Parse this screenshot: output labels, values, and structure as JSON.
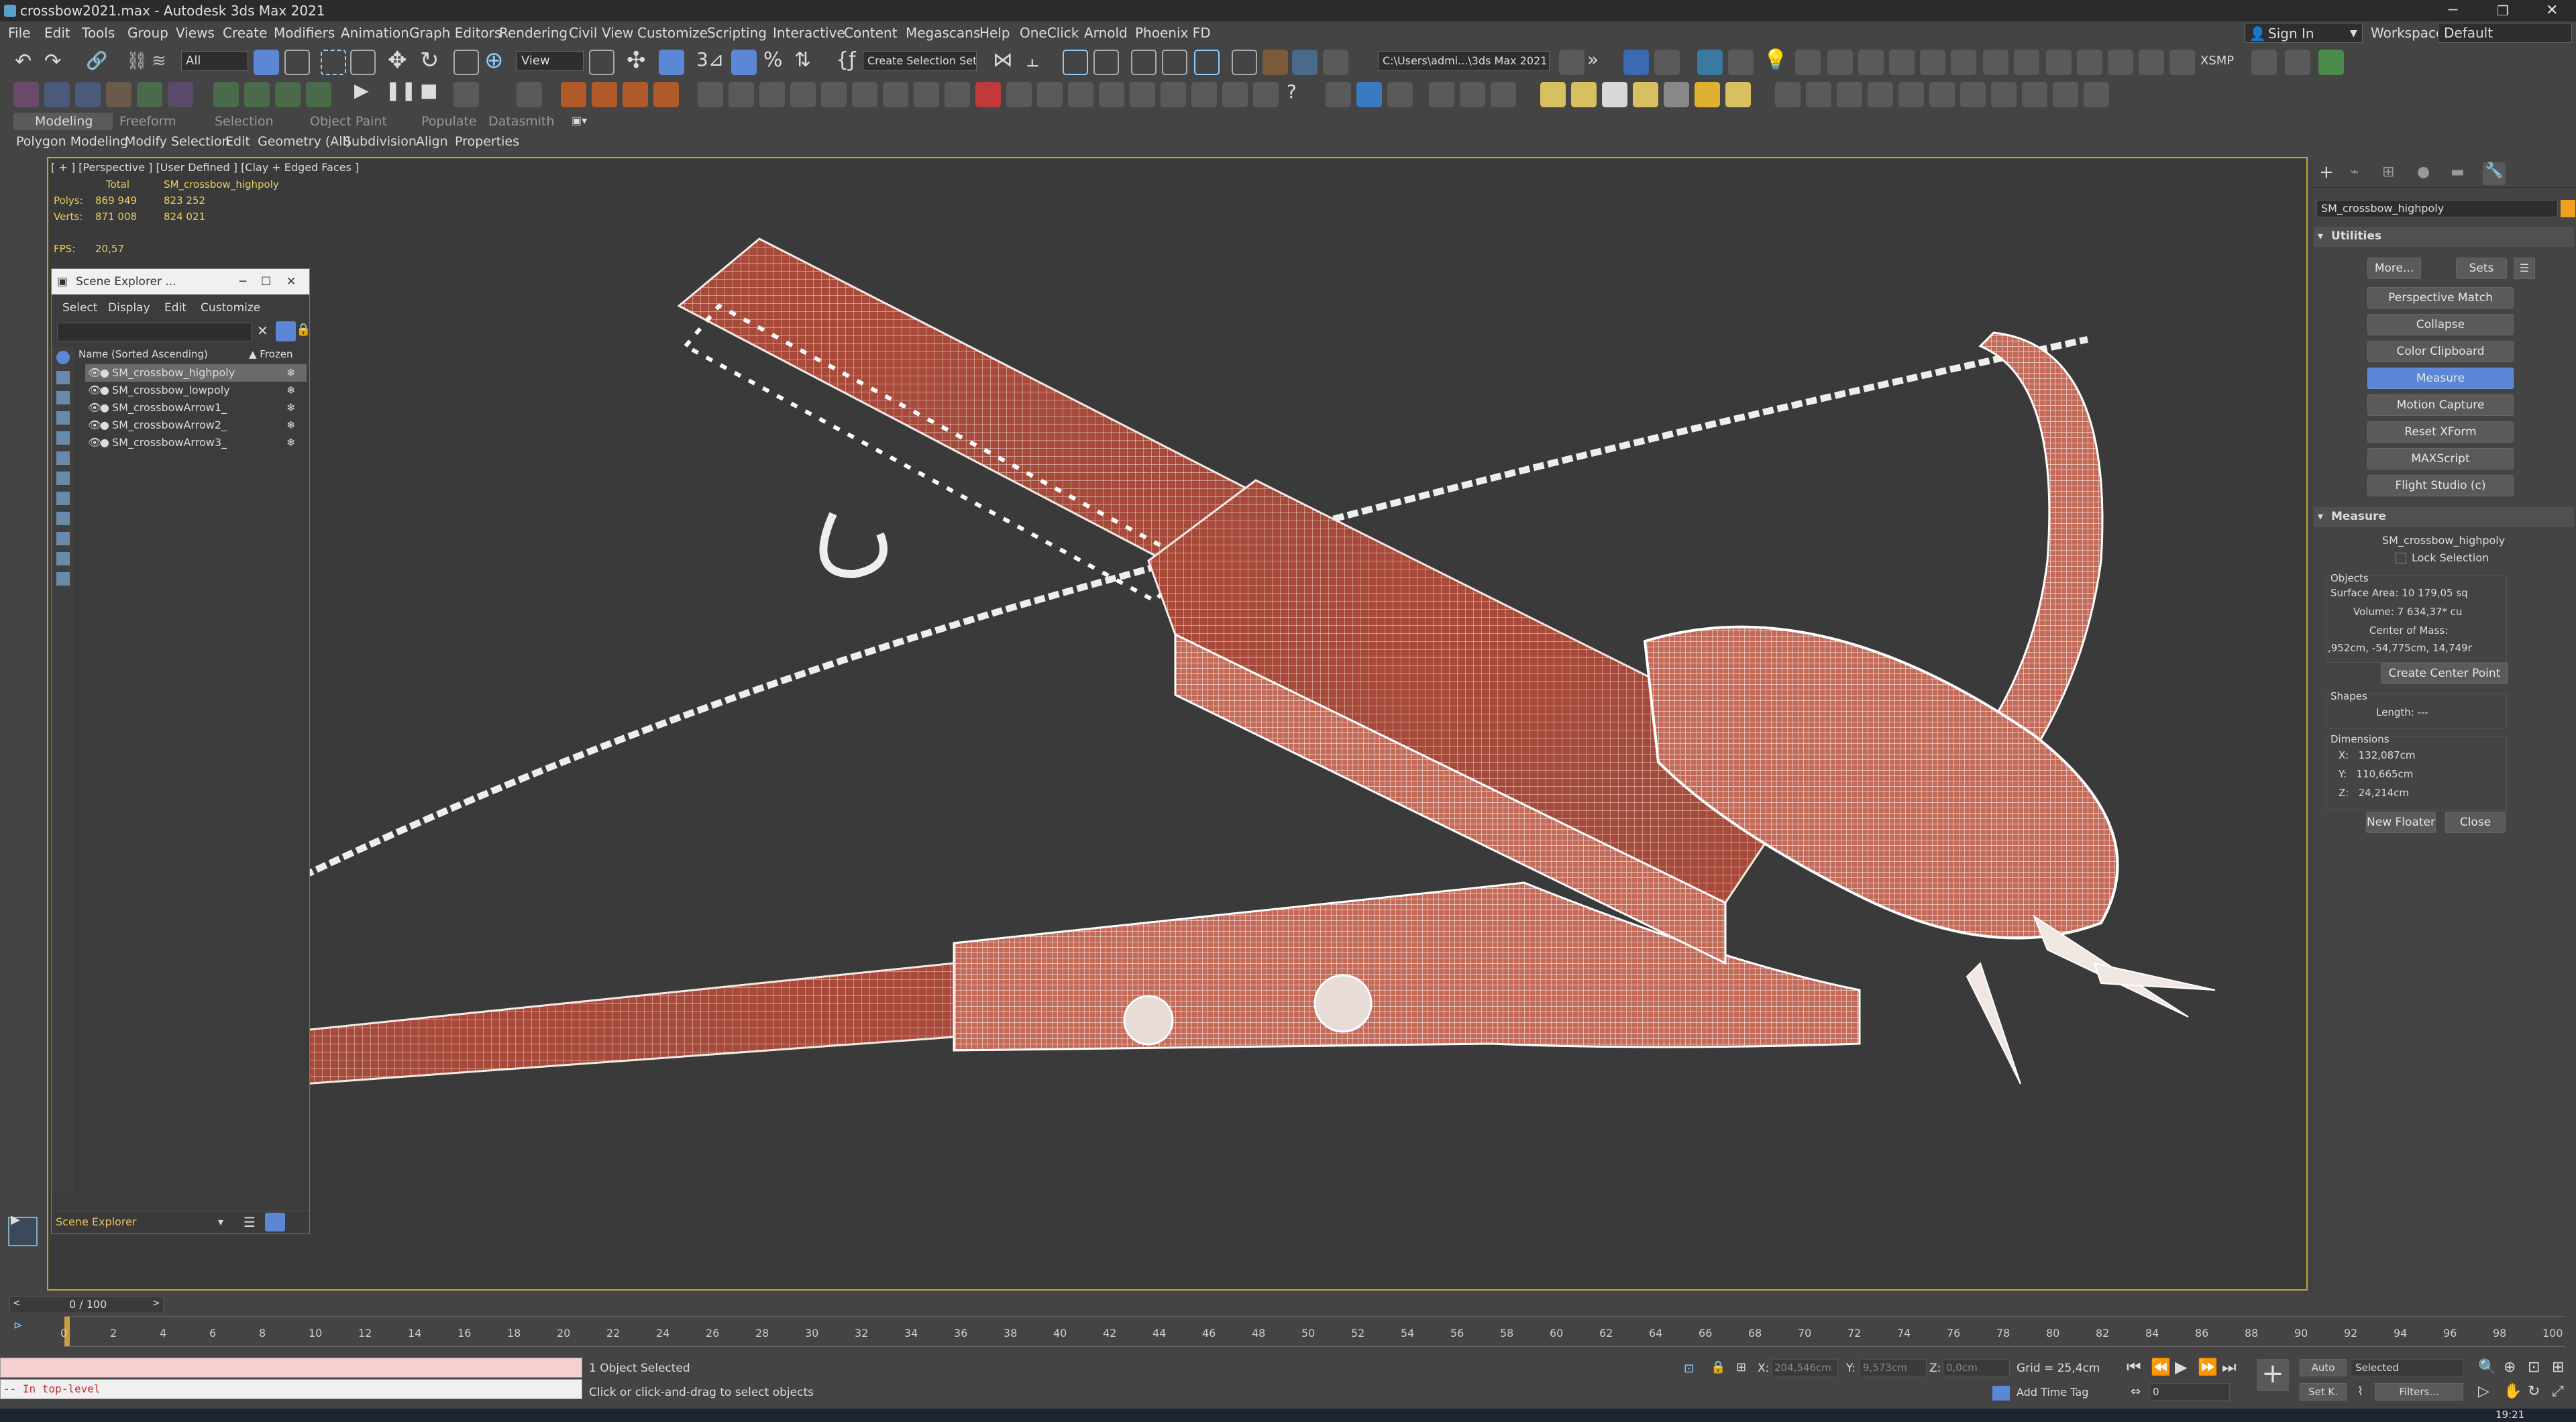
{
  "window": {
    "title": "crossbow2021.max - Autodesk 3ds Max 2021"
  },
  "menu": [
    "File",
    "Edit",
    "Tools",
    "Group",
    "Views",
    "Create",
    "Modifiers",
    "Animation",
    "Graph Editors",
    "Rendering",
    "Civil View",
    "Customize",
    "Scripting",
    "Interactive",
    "Content",
    "Megascans",
    "Help",
    "OneClick",
    "Arnold",
    "Phoenix FD"
  ],
  "account": {
    "sign_in": "Sign In",
    "workspaces_label": "Workspaces:",
    "workspace": "Default"
  },
  "toolbar": {
    "filter": "All",
    "ref_coord": "View",
    "selection_set": "Create Selection Set",
    "project_path": "C:\\Users\\admi...\\3ds Max 2021",
    "xsmp": "XSMP"
  },
  "ribbon": {
    "tabs": [
      "Modeling",
      "Freeform",
      "Selection",
      "Object Paint",
      "Populate",
      "Datasmith"
    ],
    "sub": [
      "Polygon Modeling",
      "Modify Selection",
      "Edit",
      "Geometry (All)",
      "Subdivision",
      "Align",
      "Properties"
    ]
  },
  "viewport": {
    "label": "[ + ] [Perspective ] [User Defined ] [Clay + Edged Faces ]",
    "stats": {
      "total": "Total",
      "object": "SM_crossbow_highpoly",
      "polys_label": "Polys:",
      "polys_total": "869 949",
      "polys_obj": "823 252",
      "verts_label": "Verts:",
      "verts_total": "871 008",
      "verts_obj": "824 021",
      "fps_label": "FPS:",
      "fps": "20,57"
    }
  },
  "scene_explorer": {
    "title": "Scene Explorer ...",
    "menu": [
      "Select",
      "Display",
      "Edit",
      "Customize"
    ],
    "col_name": "Name (Sorted Ascending)",
    "col_frozen": "▲ Frozen",
    "items": [
      "SM_crossbow_highpoly",
      "SM_crossbow_lowpoly",
      "SM_crossbowArrow1_",
      "SM_crossbowArrow2_",
      "SM_crossbowArrow3_"
    ],
    "footer": "Scene Explorer"
  },
  "panel": {
    "object_name": "SM_crossbow_highpoly",
    "utilities_title": "Utilities",
    "more": "More...",
    "sets": "Sets",
    "buttons": [
      "Perspective Match",
      "Collapse",
      "Color Clipboard",
      "Measure",
      "Motion Capture",
      "Reset XForm",
      "MAXScript",
      "Flight Studio (c)"
    ],
    "measure_title": "Measure",
    "measure_obj": "SM_crossbow_highpoly",
    "lock_selection": "Lock Selection",
    "objects_label": "Objects",
    "surface_area": "Surface Area: 10 179,05 sq",
    "volume": "Volume: 7 634,37* cu",
    "center_label": "Center of Mass:",
    "center": ",952cm, -54,775cm, 14,749r",
    "create_center": "Create Center Point",
    "shapes_label": "Shapes",
    "length": "Length: ---",
    "dimensions_label": "Dimensions",
    "dim_x": "X:   132,087cm",
    "dim_y": "Y:   110,665cm",
    "dim_z": "Z:   24,214cm",
    "new_floater": "New Floater",
    "close": "Close"
  },
  "timeline": {
    "frame": "0 / 100",
    "ticks": [
      "0",
      "2",
      "4",
      "6",
      "8",
      "10",
      "12",
      "14",
      "16",
      "18",
      "20",
      "22",
      "24",
      "26",
      "28",
      "30",
      "32",
      "34",
      "36",
      "38",
      "40",
      "42",
      "44",
      "46",
      "48",
      "50",
      "52",
      "54",
      "56",
      "58",
      "60",
      "62",
      "64",
      "66",
      "68",
      "70",
      "72",
      "74",
      "76",
      "78",
      "80",
      "82",
      "84",
      "86",
      "88",
      "90",
      "92",
      "94",
      "96",
      "98",
      "100"
    ]
  },
  "status": {
    "script": "-- In top-level",
    "selected": "1 Object Selected",
    "hint": "Click or click-and-drag to select objects",
    "x_label": "X:",
    "x": "204,546cm",
    "y_label": "Y:",
    "y": "9,573cm",
    "z_label": "Z:",
    "z": "0,0cm",
    "grid": "Grid = 25,4cm",
    "add_time_tag": "Add Time Tag",
    "auto": "Auto",
    "set_key": "Set K.",
    "key_filter": "Selected",
    "filters": "Filters...",
    "frame_field": "0",
    "clock": "19:21"
  },
  "colors": {
    "accent": "#c9a03e",
    "selected": "#5b87d6",
    "mesh_red": "#a84a3a",
    "wire": "#f2e8e4"
  }
}
